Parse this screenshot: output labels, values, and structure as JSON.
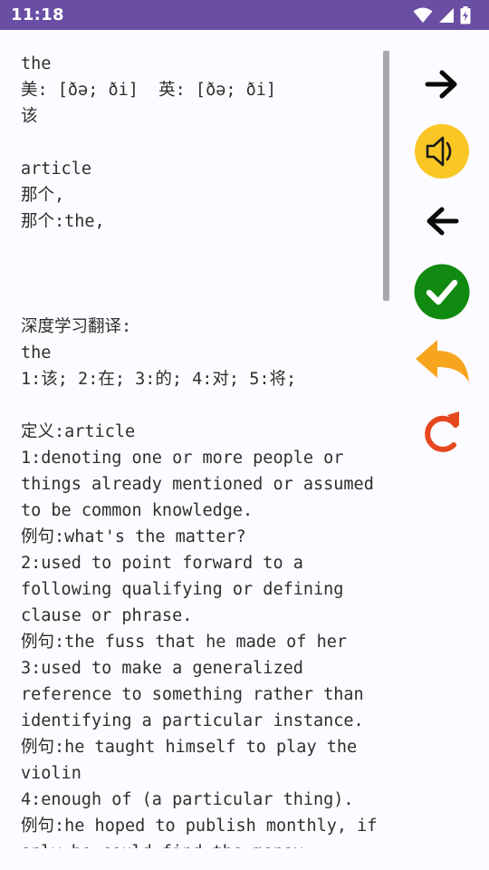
{
  "status_bar": {
    "time": "11:18",
    "icons": [
      "wifi-icon",
      "signal-icon",
      "battery-charging-icon"
    ],
    "color": "#6A4EA4"
  },
  "content": {
    "lines": [
      "the",
      "美: [ðə; ði]  英: [ðə; ði]",
      "该",
      "",
      "article",
      "那个,",
      "那个:the,",
      "",
      "",
      "",
      "深度学习翻译:",
      "the",
      "1:该; 2:在; 3:的; 4:对; 5:将;",
      "",
      "定义:article",
      "1:denoting one or more people or",
      "things already mentioned or assumed",
      "to be common knowledge.",
      "例句:what's the matter?",
      "2:used to point forward to a",
      "following qualifying or defining",
      "clause or phrase.",
      "例句:the fuss that he made of her",
      "3:used to make a generalized",
      "reference to something rather than",
      "identifying a particular instance.",
      "例句:he taught himself to play the",
      "violin",
      "4:enough of (a particular thing).",
      "例句:he hoped to publish monthly, if",
      "only he could find the money"
    ]
  },
  "actions": {
    "items": [
      {
        "name": "next-button",
        "icon": "arrow-right-icon"
      },
      {
        "name": "speak-button",
        "icon": "speaker-icon",
        "color": "#F9C623"
      },
      {
        "name": "previous-button",
        "icon": "arrow-left-icon"
      },
      {
        "name": "mark-known-button",
        "icon": "checkmark-icon",
        "color": "#108A10"
      },
      {
        "name": "undo-button",
        "icon": "undo-arrow-icon",
        "color": "#F7A51E"
      },
      {
        "name": "refresh-button",
        "icon": "redo-circular-arrow-icon",
        "color": "#E6471E"
      }
    ]
  }
}
